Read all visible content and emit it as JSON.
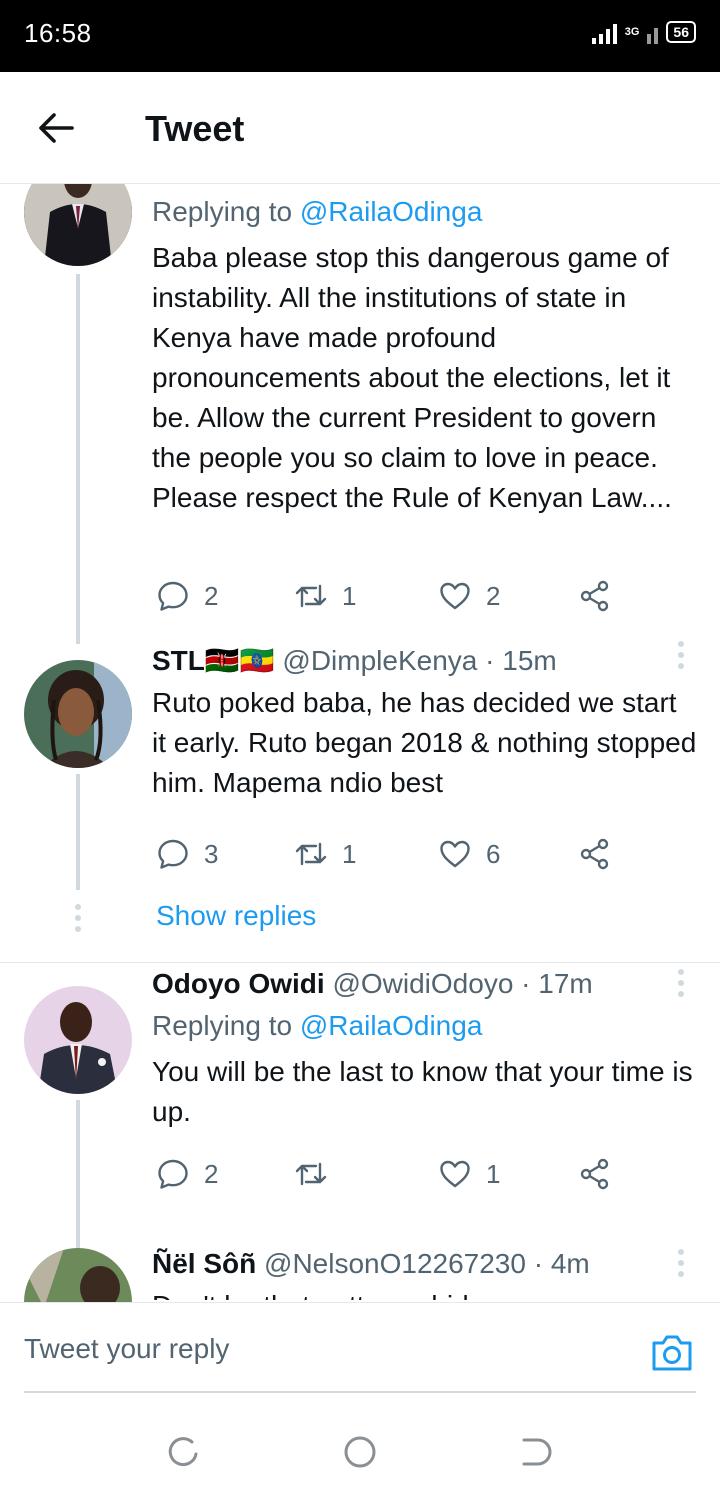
{
  "status_bar": {
    "time": "16:58",
    "network": "3G",
    "battery": "56"
  },
  "header": {
    "title": "Tweet"
  },
  "tweets": [
    {
      "replying_prefix": "Replying to ",
      "replying_to": "@RailaOdinga",
      "text": "Baba please stop this dangerous game of instability. All the institutions of state in Kenya have made profound pronouncements about the elections, let it be. Allow the current President to govern the people you so claim to love in peace. Please respect the Rule of Kenyan Law....",
      "replies": "2",
      "retweets": "1",
      "likes": "2"
    },
    {
      "name": "STL",
      "flags": "🇰🇪🇪🇹",
      "handle": "@DimpleKenya",
      "time": "15m",
      "text": "Ruto poked baba, he has decided we start it early. Ruto began 2018 & nothing stopped him. Mapema ndio best",
      "replies": "3",
      "retweets": "1",
      "likes": "6",
      "show_replies": "Show replies"
    },
    {
      "name": "Odoyo Owidi",
      "handle": "@OwidiOdoyo",
      "time": "17m",
      "replying_prefix": "Replying to ",
      "replying_to": "@RailaOdinga",
      "text": "You will be the last to know that your time is up.",
      "replies": "2",
      "retweets": "",
      "likes": "1"
    },
    {
      "name": "Ñël Sôñ",
      "handle": "@NelsonO12267230",
      "time": "4m",
      "text": "Don't be that petty ... chide mary or"
    }
  ],
  "reply_bar": {
    "placeholder": "Tweet your reply"
  },
  "colors": {
    "accent": "#1d9bf0",
    "secondary_text": "#536471",
    "thread_line": "#cfd9de"
  }
}
